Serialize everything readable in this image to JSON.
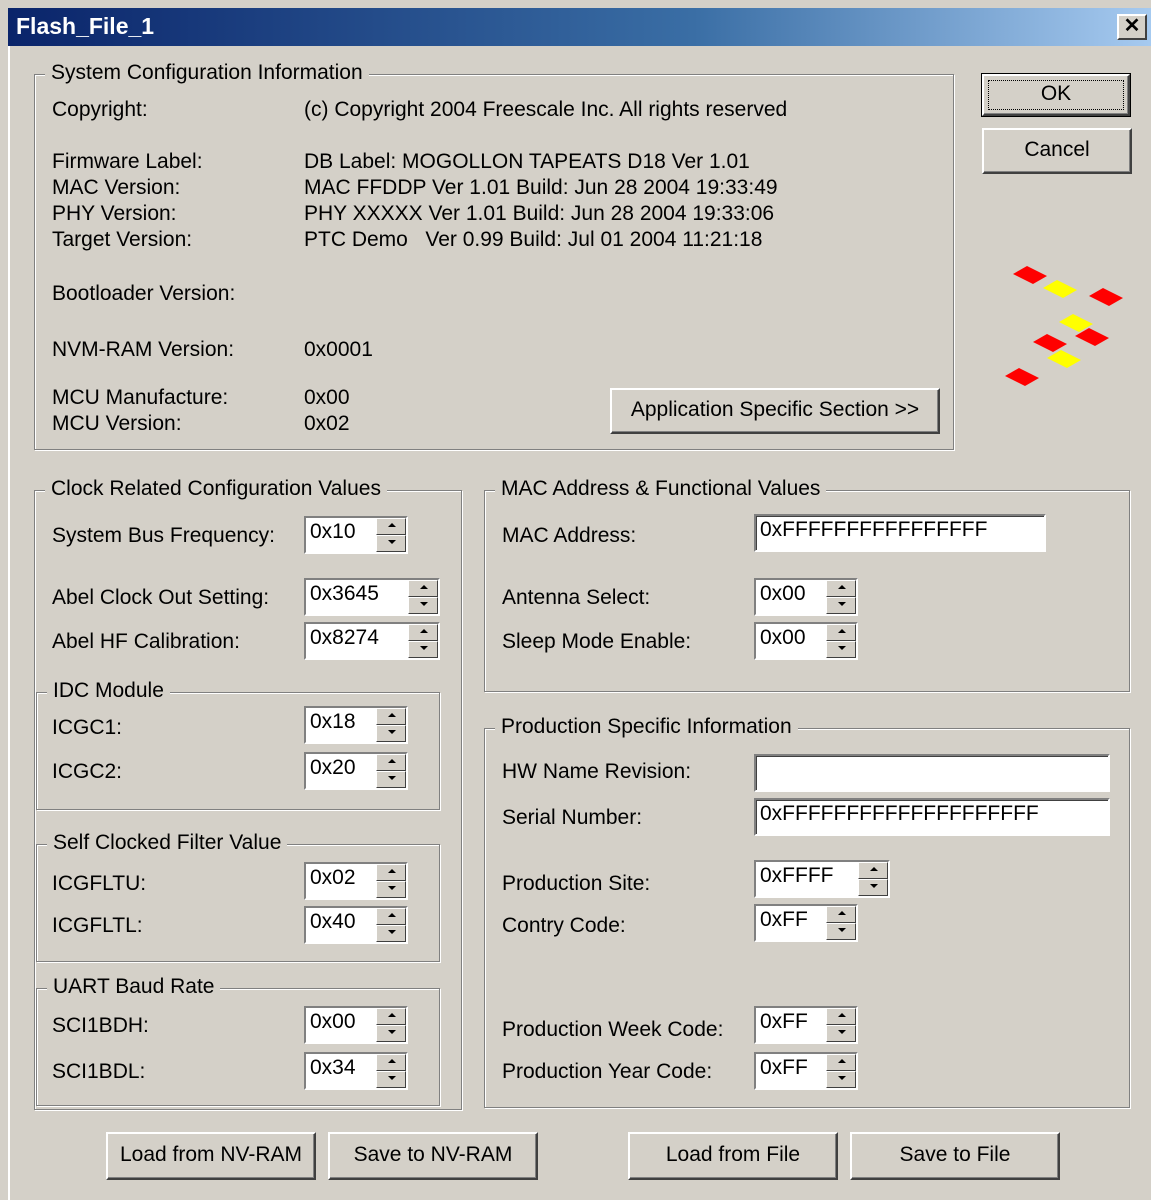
{
  "window": {
    "title": "Flash_File_1"
  },
  "buttons": {
    "ok": "OK",
    "cancel": "Cancel",
    "app_specific": "Application Specific Section >>"
  },
  "sys": {
    "legend": "System Configuration Information",
    "copyright_label": "Copyright:",
    "copyright_value": "(c) Copyright 2004 Freescale Inc. All rights reserved",
    "firmware_label": "Firmware Label:",
    "firmware_value": "DB Label: MOGOLLON TAPEATS D18 Ver 1.01",
    "mac_label": "MAC Version:",
    "mac_value": "MAC FFDDP Ver 1.01 Build: Jun 28 2004 19:33:49",
    "phy_label": "PHY Version:",
    "phy_value": "PHY XXXXX Ver 1.01 Build: Jun 28 2004 19:33:06",
    "target_label": "Target Version:",
    "target_value": "PTC Demo   Ver 0.99 Build: Jul 01 2004 11:21:18",
    "bootloader_label": "Bootloader Version:",
    "bootloader_value": "",
    "nvm_label": "NVM-RAM Version:",
    "nvm_value": "0x0001",
    "mcu_man_label": "MCU Manufacture:",
    "mcu_man_value": "0x00",
    "mcu_ver_label": "MCU Version:",
    "mcu_ver_value": "0x02"
  },
  "clock": {
    "legend": "Clock Related Configuration Values",
    "bus_label": "System Bus Frequency:",
    "bus_value": "0x10",
    "abel_out_label": "Abel Clock Out Setting:",
    "abel_out_value": "0x3645",
    "abel_hf_label": "Abel HF Calibration:",
    "abel_hf_value": "0x8274",
    "idc": {
      "legend": "IDC Module",
      "icgc1_label": "ICGC1:",
      "icgc1_value": "0x18",
      "icgc2_label": "ICGC2:",
      "icgc2_value": "0x20"
    },
    "scf": {
      "legend": "Self Clocked Filter Value",
      "ltu_label": "ICGFLTU:",
      "ltu_value": "0x02",
      "ltl_label": "ICGFLTL:",
      "ltl_value": "0x40"
    },
    "uart": {
      "legend": "UART Baud Rate",
      "bdh_label": "SCI1BDH:",
      "bdh_value": "0x00",
      "bdl_label": "SCI1BDL:",
      "bdl_value": "0x34"
    }
  },
  "mac": {
    "legend": "MAC Address & Functional Values",
    "addr_label": "MAC Address:",
    "addr_value": "0xFFFFFFFFFFFFFFFF",
    "antenna_label": "Antenna Select:",
    "antenna_value": "0x00",
    "sleep_label": "Sleep Mode Enable:",
    "sleep_value": "0x00"
  },
  "prod": {
    "legend": "Production Specific Information",
    "hw_label": "HW Name Revision:",
    "hw_value": "",
    "serial_label": "Serial Number:",
    "serial_value": "0xFFFFFFFFFFFFFFFFFFFF",
    "site_label": "Production Site:",
    "site_value": "0xFFFF",
    "country_label": "Contry Code:",
    "country_value": "0xFF",
    "week_label": "Production Week Code:",
    "week_value": "0xFF",
    "year_label": "Production Year Code:",
    "year_value": "0xFF"
  },
  "bottom": {
    "load_nv": "Load from NV-RAM",
    "save_nv": "Save to NV-RAM",
    "load_file": "Load from File",
    "save_file": "Save to File"
  },
  "colors": {
    "logo_red": "#ff0000",
    "logo_yellow": "#ffff00",
    "face": "#d4d0c8",
    "title_dark": "#0a246a"
  }
}
